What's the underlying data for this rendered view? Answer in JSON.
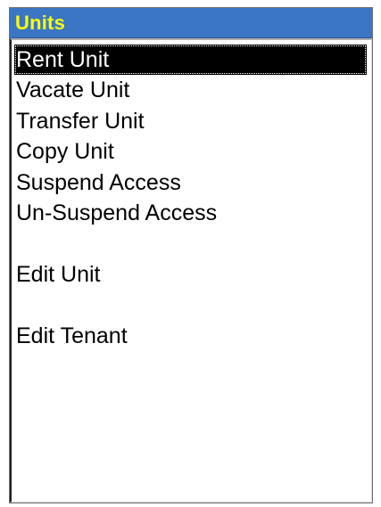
{
  "panel": {
    "title": "Units",
    "title_color": "#ffff00",
    "title_bar_color": "#3a76c4"
  },
  "list": {
    "selected_index": 0,
    "items": [
      {
        "label": "Rent Unit"
      },
      {
        "label": "Vacate Unit"
      },
      {
        "label": "Transfer Unit"
      },
      {
        "label": "Copy Unit"
      },
      {
        "label": "Suspend Access"
      },
      {
        "label": "Un-Suspend Access"
      },
      {
        "label": ""
      },
      {
        "label": "Edit Unit"
      },
      {
        "label": ""
      },
      {
        "label": "Edit Tenant"
      }
    ]
  }
}
